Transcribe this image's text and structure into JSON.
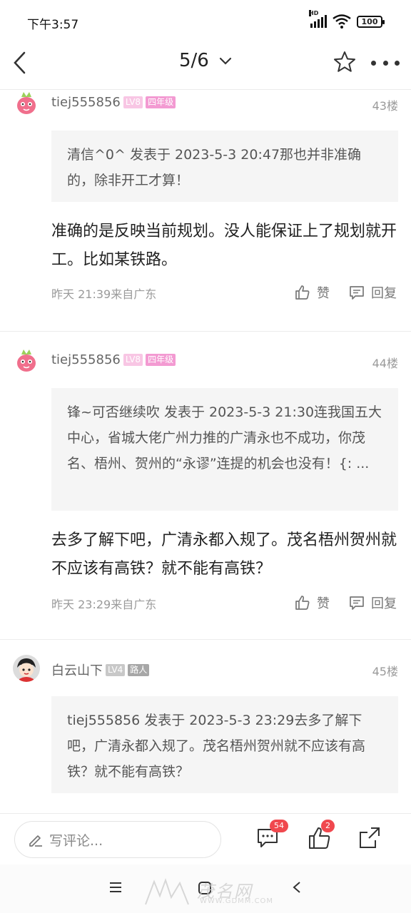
{
  "status_bar": {
    "time": "下午3:57",
    "network": "HD",
    "battery": "100"
  },
  "header": {
    "page_indicator": "5/6"
  },
  "posts": [
    {
      "username": "tiej555856",
      "level": "LV8",
      "grade": "四年级",
      "floor": "43楼",
      "quote": "清信^0^ 发表于 2023-5-3 20:47那也并非准确的，除非开工才算！",
      "content": "准确的是反映当前规划。没人能保证上了规划就开工。比如某铁路。",
      "meta": "昨天 21:39来自广东",
      "like_label": "赞",
      "reply_label": "回复"
    },
    {
      "username": "tiej555856",
      "level": "LV8",
      "grade": "四年级",
      "floor": "44楼",
      "quote": "锋~可否继续吹 发表于 2023-5-3 21:30连我国五大中心，省城大佬广州力推的广清永也不成功，你茂名、梧州、贺州的“永谬”连提的机会也没有！{: ...",
      "content": "去多了解下吧，广清永都入规了。茂名梧州贺州就不应该有高铁？就不能有高铁？",
      "meta": "昨天 23:29来自广东",
      "like_label": "赞",
      "reply_label": "回复"
    },
    {
      "username": "白云山下",
      "level": "LV4",
      "grade": "路人",
      "floor": "45楼",
      "quote": "tiej555856 发表于 2023-5-3 23:29去多了解下吧，广清永都入规了。茂名梧州贺州就不应该有高铁？就不能有高铁？"
    }
  ],
  "bottom_bar": {
    "comment_placeholder": "写评论...",
    "comment_count": "54",
    "like_count": "2"
  },
  "watermark": {
    "text": "茂名网",
    "url": "WWW.GDMM.COM"
  },
  "colors": {
    "accent": "#f0484e",
    "badge_pink": "#f39ad2",
    "quote_bg": "#f5f5f5"
  }
}
